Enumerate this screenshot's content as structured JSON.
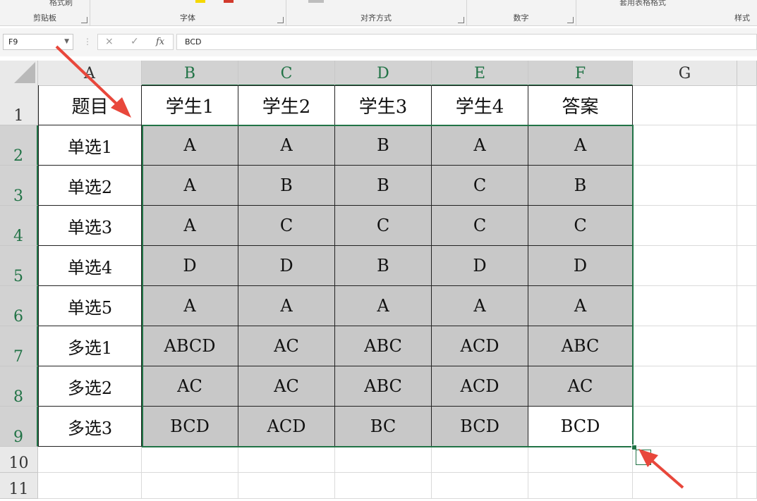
{
  "ribbon": {
    "groups": [
      {
        "label": "剪贴板"
      },
      {
        "label": "字体"
      },
      {
        "label": "对齐方式"
      },
      {
        "label": "数字"
      },
      {
        "label": "样式"
      }
    ],
    "format_painter_label": "格式刷",
    "table_format_label": "套用表格格式"
  },
  "formula_bar": {
    "name_box": "F9",
    "cancel_icon": "×",
    "enter_icon": "✓",
    "fx_label": "fx",
    "content": "BCD"
  },
  "sheet": {
    "columns": [
      "A",
      "B",
      "C",
      "D",
      "E",
      "F",
      "G"
    ],
    "rows": [
      "1",
      "2",
      "3",
      "4",
      "5",
      "6",
      "7",
      "8",
      "9",
      "10",
      "11"
    ],
    "header_row": [
      "题目",
      "学生1",
      "学生2",
      "学生3",
      "学生4",
      "答案"
    ],
    "data": [
      [
        "单选1",
        "A",
        "A",
        "B",
        "A",
        "A"
      ],
      [
        "单选2",
        "A",
        "B",
        "B",
        "C",
        "B"
      ],
      [
        "单选3",
        "A",
        "C",
        "C",
        "C",
        "C"
      ],
      [
        "单选4",
        "D",
        "D",
        "B",
        "D",
        "D"
      ],
      [
        "单选5",
        "A",
        "A",
        "A",
        "A",
        "A"
      ],
      [
        "多选1",
        "ABCD",
        "AC",
        "ABC",
        "ACD",
        "ABC"
      ],
      [
        "多选2",
        "AC",
        "AC",
        "ABC",
        "ACD",
        "AC"
      ],
      [
        "多选3",
        "BCD",
        "ACD",
        "BC",
        "BCD",
        "BCD"
      ]
    ],
    "selection_range_color": "#217346",
    "selected_fill_color": "#c8c8c8",
    "annotation_arrow_color": "#e8473b"
  }
}
